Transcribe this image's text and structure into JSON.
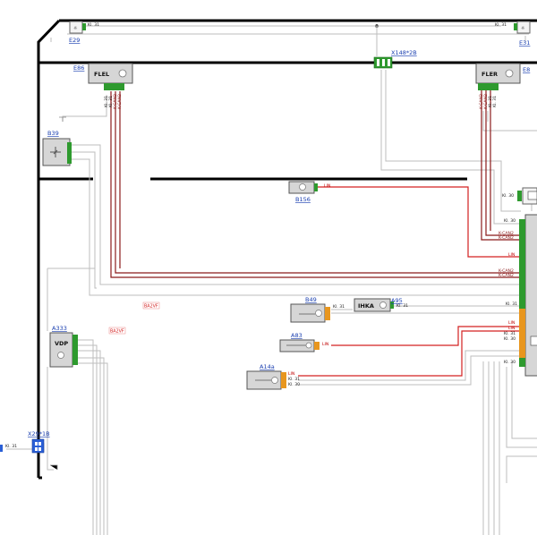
{
  "components": {
    "e29": {
      "ref": "E29",
      "pin": "Kl. 31"
    },
    "e31": {
      "ref": "E31",
      "pin": "Kl. 31"
    },
    "x148": {
      "ref": "X148*2B"
    },
    "e86": {
      "ref": "E86",
      "label": "FLEL",
      "pins": [
        "Kl. 31",
        "Kl. 31",
        "K-CAN2",
        "K-CAN2"
      ]
    },
    "e85": {
      "ref": "E8",
      "label": "FLER",
      "pins": [
        "K-CAN2",
        "K-CAN2",
        "Kl. 31",
        "Kl. 31"
      ]
    },
    "b39": {
      "ref": "B39"
    },
    "b156": {
      "ref": "B156",
      "pin": "LIN"
    },
    "b49": {
      "ref": "B49",
      "pin": "Kl. 31"
    },
    "a95": {
      "ref": "A95",
      "label": "IHKA",
      "pin": "Kl. 31"
    },
    "a83": {
      "ref": "A83",
      "pin": "LIN"
    },
    "a14": {
      "ref": "A14a",
      "pins": [
        "LIN",
        "Kl. 31",
        "Kl. 30"
      ]
    },
    "a333": {
      "ref": "A333",
      "label": "VDP"
    },
    "x29": {
      "ref": "X29*1B",
      "pin": "Kl. 31"
    },
    "right_cut": {
      "pin": "Kl. 30"
    }
  },
  "notes": {
    "bazvf1": "BA2VF",
    "bazvf2": "BA2VF"
  },
  "module_pins": {
    "p1": "Kl. 30",
    "p2": "K-CAN2",
    "p3": "K-CAN2",
    "p4": "LIN",
    "p5": "K-CAN2",
    "p6": "K-CAN2",
    "p7": "Kl. 31",
    "p8": "LIN",
    "p9": "LIN",
    "p10": "Kl. 31",
    "p11": "Kl. 30",
    "p12": "Kl. 30"
  },
  "colors": {
    "lin_wire": "#d32020",
    "can_wire": "#8b1a1a",
    "ground_wire": "#bdbdbd",
    "connector_green": "#2e9a2e",
    "connector_orange": "#e8961e",
    "connector_blue": "#2a5fd6",
    "ref_blue": "#1a3fb0"
  },
  "icons": {
    "lamp": "lamp-icon",
    "sensor": "sensor-icon",
    "ground": "ground-icon"
  }
}
